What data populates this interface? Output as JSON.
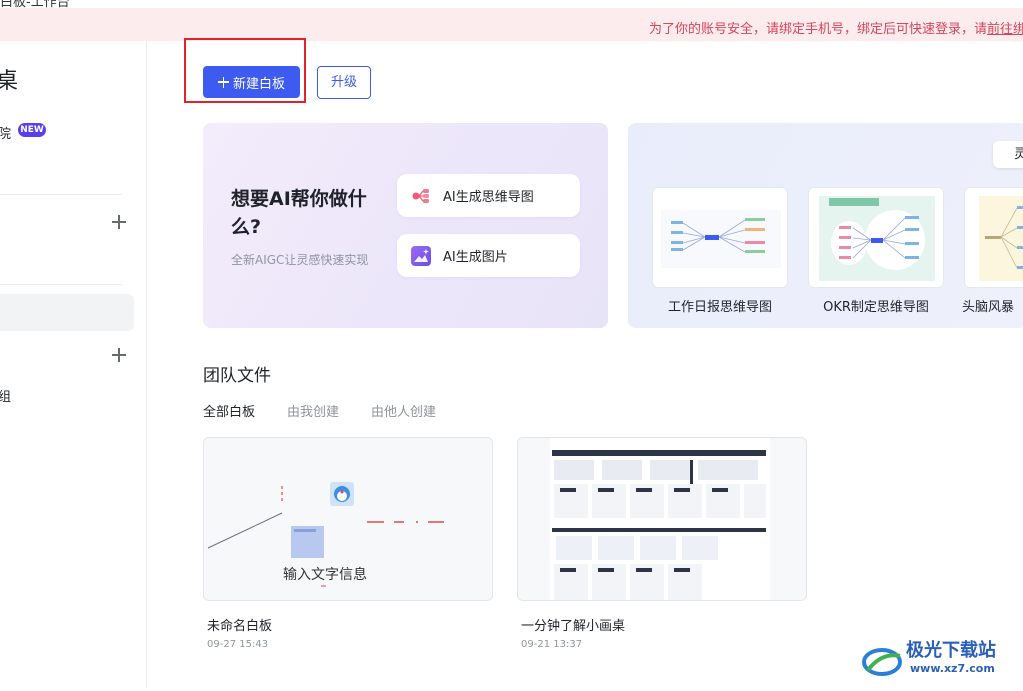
{
  "window": {
    "title": "白板-工作台"
  },
  "banner": {
    "message": "为了你的账号安全，请绑定手机号，绑定后可快速登录，请",
    "link_text": "前往绑"
  },
  "sidebar": {
    "heading_fragment": "桌",
    "item1_fragment": "院",
    "new_badge": "NEW",
    "item2_fragment": "组"
  },
  "toolbar": {
    "new_board_label": "新建白板",
    "upgrade_label": "升级"
  },
  "ai_card": {
    "title": "想要AI帮你做什么?",
    "subtitle": "全新AIGC让灵感快速实现",
    "mindmap_label": "AI生成思维导图",
    "image_label": "AI生成图片"
  },
  "templates": {
    "pill_label": "灵",
    "items": [
      {
        "label": "工作日报思维导图"
      },
      {
        "label": "OKR制定思维导图"
      },
      {
        "label": "头脑风暴"
      }
    ]
  },
  "team_files": {
    "title": "团队文件",
    "tabs": [
      {
        "label": "全部白板",
        "active": true
      },
      {
        "label": "由我创建",
        "active": false
      },
      {
        "label": "由他人创建",
        "active": false
      }
    ],
    "files": [
      {
        "name": "未命名白板",
        "time": "09-27 15:43",
        "preview_text": "输入文字信息"
      },
      {
        "name": "一分钟了解小画桌",
        "time": "09-21 13:37"
      }
    ]
  },
  "watermark": {
    "text": "极光下载站",
    "url": "www.xz7.com"
  },
  "colors": {
    "accent": "#3d5af1",
    "banner_bg": "#fdecee",
    "banner_text": "#d6455a",
    "badge": "#5a3ff0",
    "highlight_box": "#e0242b"
  }
}
